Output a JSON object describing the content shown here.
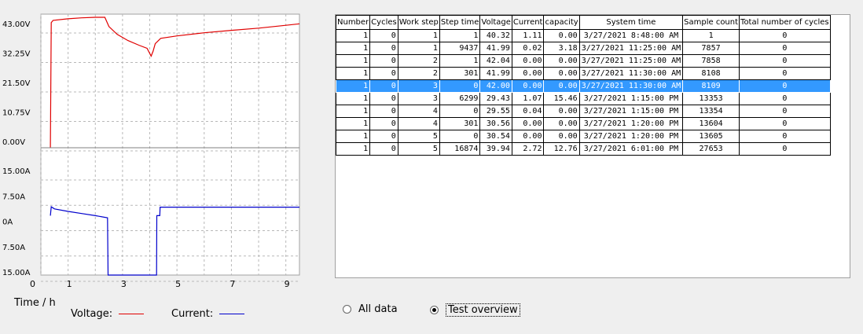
{
  "chart_data": [
    {
      "type": "line",
      "ylabel": "",
      "y_ticks": [
        "43.00V",
        "32.25V",
        "21.50V",
        "10.75V",
        "0.00V"
      ],
      "ylim": [
        0,
        43
      ],
      "x_ticks": [
        "0",
        "1",
        "3",
        "5",
        "7",
        "9"
      ],
      "xlim": [
        0,
        9.5
      ],
      "grid": true,
      "series": [
        {
          "name": "Voltage",
          "color": "#e00000",
          "x": [
            0.35,
            0.38,
            0.45,
            1.0,
            1.5,
            2.0,
            2.35,
            2.5,
            2.8,
            3.2,
            3.6,
            3.9,
            4.05,
            4.12,
            4.2,
            4.4,
            5.0,
            6.0,
            7.0,
            8.0,
            9.0,
            9.5
          ],
          "y": [
            0,
            40.3,
            41.0,
            41.5,
            41.8,
            42.0,
            42.0,
            39.0,
            36.5,
            34.5,
            33.0,
            32.0,
            29.5,
            31.0,
            33.5,
            35.2,
            36.0,
            37.0,
            37.8,
            38.5,
            39.4,
            39.9
          ]
        }
      ]
    },
    {
      "type": "line",
      "y_ticks": [
        "15.00A",
        "7.50A",
        "0A",
        "7.50A",
        "15.00A"
      ],
      "ylim": [
        -15,
        15
      ],
      "x_ticks": [
        "0",
        "1",
        "3",
        "5",
        "7",
        "9"
      ],
      "xlim": [
        0,
        9.5
      ],
      "grid": true,
      "series": [
        {
          "name": "Current",
          "color": "#0000cc",
          "x": [
            0.35,
            0.38,
            0.5,
            1.0,
            1.5,
            2.0,
            2.45,
            2.47,
            2.5,
            4.2,
            4.25,
            4.26,
            4.37,
            4.38,
            9.5
          ],
          "y": [
            -1,
            1.1,
            0.6,
            0,
            -0.5,
            -1.0,
            -1.5,
            -15,
            -15,
            -15,
            -15,
            -1,
            -1,
            1.0,
            1.0
          ]
        }
      ]
    }
  ],
  "x_title": "Time / h",
  "legend": [
    {
      "label": "Voltage:",
      "color": "#e00000"
    },
    {
      "label": "Current:",
      "color": "#0000cc"
    }
  ],
  "table": {
    "columns": [
      "Number",
      "Cycles",
      "Work step",
      "Step time",
      "Voltage",
      "Current",
      "capacity",
      "System time",
      "Sample count",
      "Total number of cycles"
    ],
    "rows": [
      [
        "1",
        "0",
        "1",
        "1",
        "40.32",
        "1.11",
        "0.00",
        "3/27/2021 8:48:00 AM",
        "1",
        "0"
      ],
      [
        "1",
        "0",
        "1",
        "9437",
        "41.99",
        "0.02",
        "3.18",
        "3/27/2021 11:25:00 AM",
        "7857",
        "0"
      ],
      [
        "1",
        "0",
        "2",
        "1",
        "42.04",
        "0.00",
        "0.00",
        "3/27/2021 11:25:00 AM",
        "7858",
        "0"
      ],
      [
        "1",
        "0",
        "2",
        "301",
        "41.99",
        "0.00",
        "0.00",
        "3/27/2021 11:30:00 AM",
        "8108",
        "0"
      ],
      [
        "1",
        "0",
        "3",
        "0",
        "42.00",
        "0.00",
        "0.00",
        "3/27/2021 11:30:00 AM",
        "8109",
        "0"
      ],
      [
        "1",
        "0",
        "3",
        "6299",
        "29.43",
        "1.07",
        "15.46",
        "3/27/2021 1:15:00 PM",
        "13353",
        "0"
      ],
      [
        "1",
        "0",
        "4",
        "0",
        "29.55",
        "0.04",
        "0.00",
        "3/27/2021 1:15:00 PM",
        "13354",
        "0"
      ],
      [
        "1",
        "0",
        "4",
        "301",
        "30.56",
        "0.00",
        "0.00",
        "3/27/2021 1:20:00 PM",
        "13604",
        "0"
      ],
      [
        "1",
        "0",
        "5",
        "0",
        "30.54",
        "0.00",
        "0.00",
        "3/27/2021 1:20:00 PM",
        "13605",
        "0"
      ],
      [
        "1",
        "0",
        "5",
        "16874",
        "39.94",
        "2.72",
        "12.76",
        "3/27/2021 6:01:00 PM",
        "27653",
        "0"
      ]
    ],
    "selected_row": 4
  },
  "radios": [
    {
      "label": "All data",
      "checked": false
    },
    {
      "label": "Test overview",
      "checked": true
    }
  ]
}
